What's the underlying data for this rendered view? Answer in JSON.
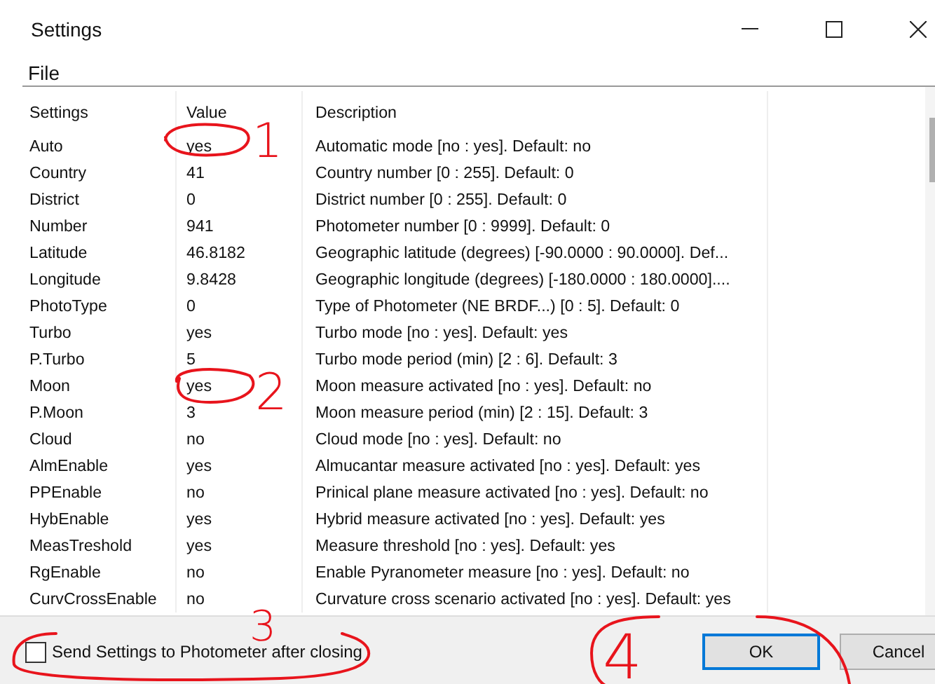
{
  "window": {
    "title": "Settings"
  },
  "menu": [
    "File"
  ],
  "table": {
    "columns": [
      "Settings",
      "Value",
      "Description"
    ],
    "rows": [
      {
        "name": "Auto",
        "value": "yes",
        "description": "Automatic mode [no : yes]. Default: no"
      },
      {
        "name": "Country",
        "value": "41",
        "description": "Country number [0 : 255]. Default: 0"
      },
      {
        "name": "District",
        "value": "0",
        "description": "District number [0 : 255]. Default: 0"
      },
      {
        "name": "Number",
        "value": "941",
        "description": "Photometer number [0 : 9999]. Default: 0"
      },
      {
        "name": "Latitude",
        "value": "46.8182",
        "description": "Geographic latitude (degrees) [-90.0000 : 90.0000]. Def..."
      },
      {
        "name": "Longitude",
        "value": "9.8428",
        "description": "Geographic longitude (degrees) [-180.0000 : 180.0000]...."
      },
      {
        "name": "PhotoType",
        "value": "0",
        "description": "Type of Photometer (NE BRDF...) [0 : 5]. Default: 0"
      },
      {
        "name": "Turbo",
        "value": "yes",
        "description": "Turbo mode [no : yes]. Default: yes"
      },
      {
        "name": "P.Turbo",
        "value": "5",
        "description": "Turbo mode period (min) [2 : 6]. Default: 3"
      },
      {
        "name": "Moon",
        "value": "yes",
        "description": "Moon measure activated [no : yes]. Default: no"
      },
      {
        "name": "P.Moon",
        "value": "3",
        "description": "Moon measure period (min) [2 : 15]. Default: 3"
      },
      {
        "name": "Cloud",
        "value": "no",
        "description": "Cloud mode [no : yes]. Default: no"
      },
      {
        "name": "AlmEnable",
        "value": "yes",
        "description": "Almucantar measure activated [no : yes]. Default: yes"
      },
      {
        "name": "PPEnable",
        "value": "no",
        "description": "Prinical plane measure activated [no : yes]. Default: no"
      },
      {
        "name": "HybEnable",
        "value": "yes",
        "description": "Hybrid measure activated [no : yes]. Default: yes"
      },
      {
        "name": "MeasTreshold",
        "value": "yes",
        "description": "Measure threshold [no : yes]. Default: yes"
      },
      {
        "name": "RgEnable",
        "value": "no",
        "description": "Enable Pyranometer measure [no : yes]. Default: no"
      },
      {
        "name": "CurvCrossEnable",
        "value": "no",
        "description": "Curvature cross scenario activated [no : yes]. Default: yes"
      }
    ]
  },
  "send_checkbox": {
    "label": "Send Settings to Photometer after closing",
    "checked": false
  },
  "buttons": [
    {
      "label": "OK",
      "default": true
    },
    {
      "label": "Cancel",
      "default": false
    }
  ],
  "annotations": [
    {
      "label": "1"
    },
    {
      "label": "2"
    },
    {
      "label": "3"
    },
    {
      "label": "4"
    }
  ]
}
